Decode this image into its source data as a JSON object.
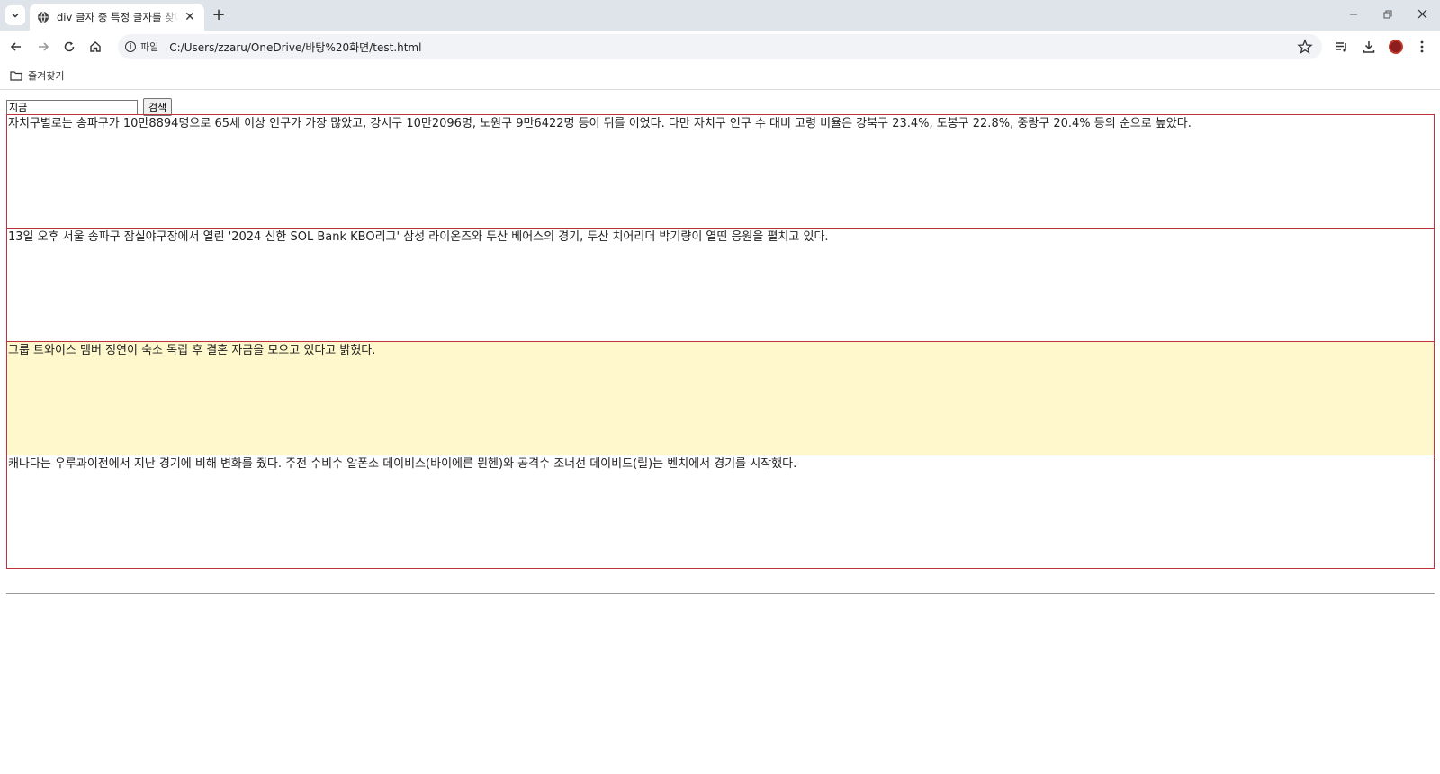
{
  "browser": {
    "tab_title": "div 글자 중 특정 글자를 찾아 ㅂ",
    "close_glyph": "✕",
    "new_tab_glyph": "+",
    "omnibox": {
      "info_label": "파일",
      "url": "C:/Users/zzaru/OneDrive/바탕%20화면/test.html"
    },
    "bookmarks": {
      "folder_label": "즐겨찾기"
    }
  },
  "page": {
    "search_value": "지금",
    "search_button": "검색",
    "paragraphs": [
      "자치구별로는 송파구가 10만8894명으로 65세 이상 인구가 가장 많았고, 강서구 10만2096명, 노원구 9만6422명 등이 뒤를 이었다. 다만 자치구 인구 수 대비 고령 비율은 강북구 23.4%, 도봉구 22.8%, 중랑구 20.4% 등의 순으로 높았다.",
      "13일 오후 서울 송파구 잠실야구장에서 열린 '2024 신한 SOL Bank KBO리그' 삼성 라이온즈와 두산 베어스의 경기, 두산 치어리더 박기량이 열띤 응원을 펼치고 있다.",
      "그룹 트와이스 멤버 정연이 숙소 독립 후 결혼 자금을 모으고 있다고 밝혔다.",
      "캐나다는 우루과이전에서 지난 경기에 비해 변화를 줬다. 주전 수비수 알폰소 데이비스(바이에른 뮌헨)와 공격수 조너선 데이비드(릴)는 벤치에서 경기를 시작했다."
    ],
    "highlight_color": "#fff8cc",
    "border_color": "#c0323a"
  }
}
